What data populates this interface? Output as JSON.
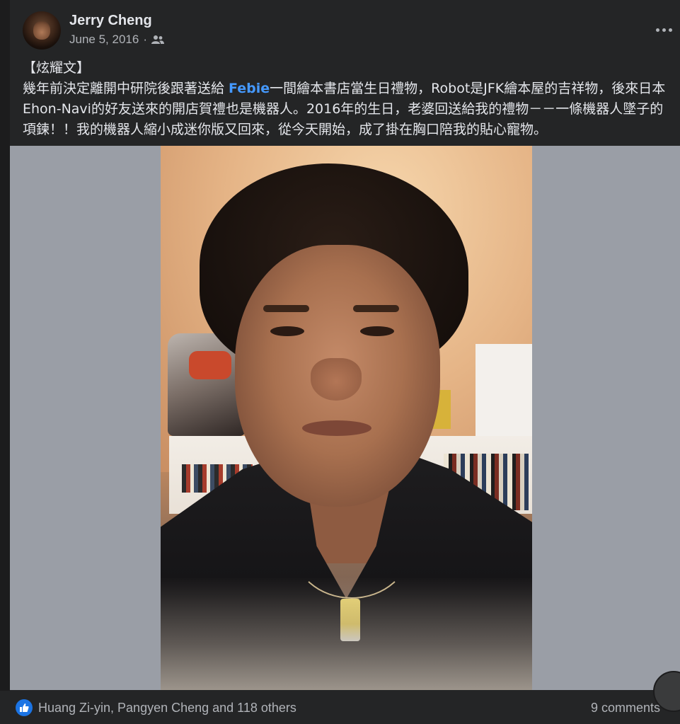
{
  "post": {
    "author": "Jerry Cheng",
    "date": "June 5, 2016",
    "separator": "·",
    "privacy_icon": "friends-icon",
    "text": {
      "tag": "【炫耀文】",
      "before_link": "幾年前決定離開中研院後跟著送給 ",
      "link": "Febie",
      "after_link": "一間繪本書店當生日禮物，Robot是JFK繪本屋的吉祥物，後來日本Ehon-Navi的好友送來的開店賀禮也是機器人。2016年的生日，老婆回送給我的禮物－－一條機器人墜子的項鍊！！我的機器人縮小成迷你版又回來，從今天開始，成了掛在胸口陪我的貼心寵物。"
    }
  },
  "footer": {
    "reaction_icon": "like-icon",
    "reactors": "Huang Zi-yin, Pangyen Cheng and 118 others",
    "comments": "9 comments"
  },
  "colors": {
    "background": "#242526",
    "link": "#4599ff",
    "like": "#1b74e4"
  }
}
